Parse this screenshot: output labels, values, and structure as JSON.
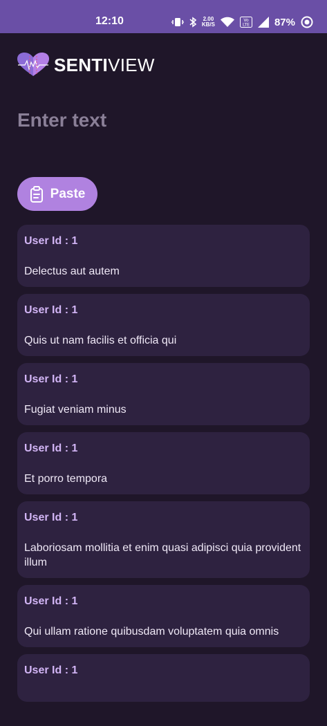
{
  "status_bar": {
    "time": "12:10",
    "speed_value": "2.00",
    "speed_unit": "KB/S",
    "volte": "Vo LTE",
    "battery": "87%",
    "icons": [
      "vibrate-icon",
      "bluetooth-icon",
      "wifi-icon",
      "signal-icon",
      "record-icon"
    ]
  },
  "logo": {
    "brand_bold": "SENTI",
    "brand_light": "VIEW",
    "colors": {
      "left_heart": "#8b6bd6",
      "right_heart": "#b37fe6"
    }
  },
  "input": {
    "placeholder": "Enter text",
    "value": ""
  },
  "paste_button": {
    "label": "Paste",
    "icon": "clipboard-icon"
  },
  "items": [
    {
      "user": "User Id : 1",
      "text": "Delectus aut autem"
    },
    {
      "user": "User Id : 1",
      "text": "Quis ut nam facilis et officia qui"
    },
    {
      "user": "User Id : 1",
      "text": "Fugiat veniam minus"
    },
    {
      "user": "User Id : 1",
      "text": "Et porro tempora"
    },
    {
      "user": "User Id : 1",
      "text": "Laboriosam mollitia et enim quasi adipisci quia provident illum"
    },
    {
      "user": "User Id : 1",
      "text": "Qui ullam ratione quibusdam voluptatem quia omnis"
    },
    {
      "user": "User Id : 1",
      "text": ""
    }
  ],
  "colors": {
    "background": "#1f1629",
    "status_bar": "#6a4fa6",
    "card": "#2e2240",
    "accent": "#b082e0",
    "user_label": "#d2b5f5"
  }
}
